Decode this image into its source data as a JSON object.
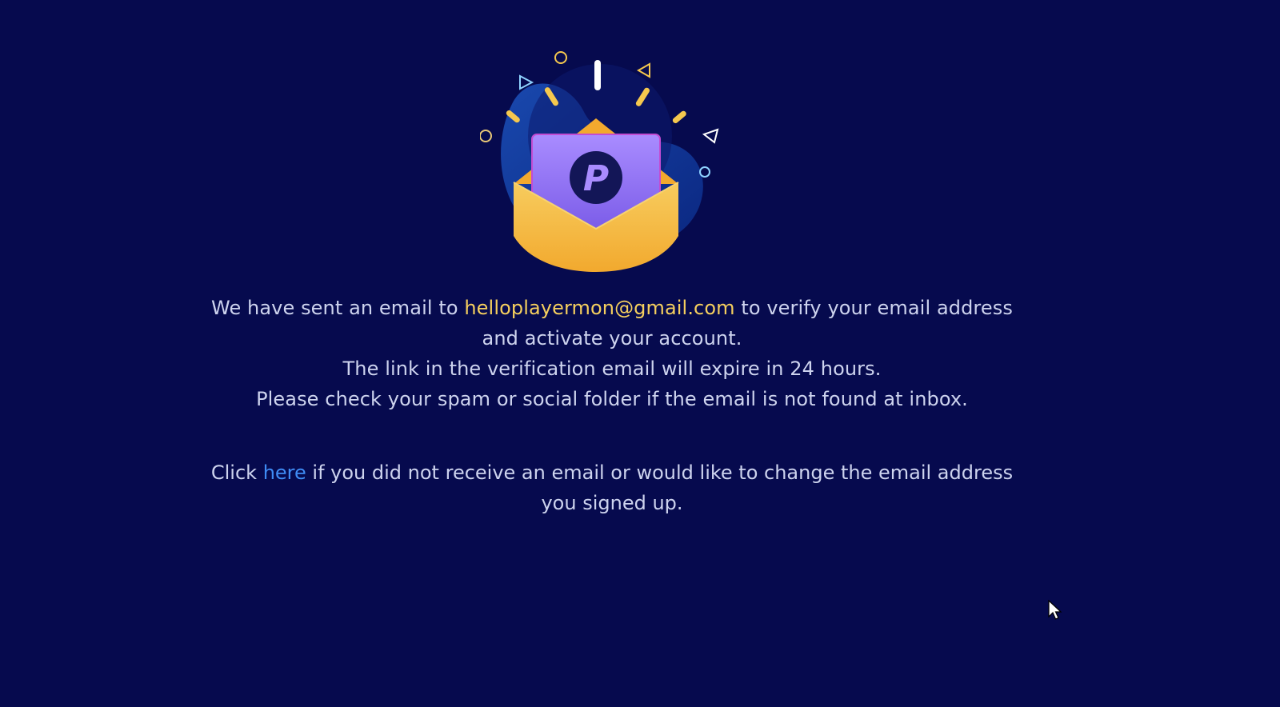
{
  "verification": {
    "line1_prefix": "We have sent an email to ",
    "email": "helloplayermon@gmail.com",
    "line1_suffix": " to verify your email address and activate your account.",
    "line2": "The link in the verification email will expire in 24 hours.",
    "line3": "Please check your spam or social folder if the email is not found at inbox."
  },
  "resend": {
    "prefix": "Click ",
    "link_label": "here",
    "suffix": " if you did not receive an email or would like to change the email address you signed up."
  },
  "illustration": {
    "logo_letter": "P",
    "icon": "open-envelope-icon"
  },
  "colors": {
    "background": "#060a4e",
    "text": "#cdd3ee",
    "email_highlight": "#f5cf5e",
    "link": "#3f8cf5",
    "envelope": "#f3b33d",
    "card": "#8a6cf0"
  }
}
